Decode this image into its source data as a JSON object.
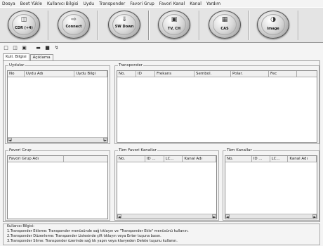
{
  "menu": [
    "Dosya",
    "Boot Yükle",
    "Kullanıcı Bilgisi",
    "Uydu",
    "Transponder",
    "Favori Grup",
    "Favori Kanal",
    "Kanal",
    "Yardım"
  ],
  "toolbar": {
    "buttons": [
      {
        "label": "CDR (+4)",
        "icon": "cdr-icon"
      },
      {
        "label": "Connect",
        "icon": "connect-icon"
      },
      {
        "label": "SW Down",
        "icon": "sw-down-icon"
      },
      {
        "label": "TV, CH",
        "icon": "tv-ch-icon"
      },
      {
        "label": "CAS",
        "icon": "cas-icon"
      },
      {
        "label": "Image",
        "icon": "image-icon"
      }
    ]
  },
  "small_toolbar": [
    "new-icon",
    "open-icon",
    "save-icon",
    "print-icon",
    "export-icon",
    "tools-icon"
  ],
  "tabs": [
    "Kull. Bilgisi",
    "Açıklama"
  ],
  "uydular": {
    "title": "Uydular",
    "columns": [
      "No",
      "Uydu Adı",
      "Uydu Bilgi"
    ]
  },
  "transponder": {
    "title": "Transponder",
    "columns": [
      "No.",
      "ID",
      "Frekans",
      "Sembol.",
      "Polar.",
      "Fec"
    ]
  },
  "favori_grup": {
    "title": "Favori Grup",
    "columns": [
      "Favori Grup Adı"
    ]
  },
  "tum_favori": {
    "title": "Tüm Favori Kanallar",
    "columns": [
      "No.",
      "ID ...",
      "LC...",
      "Kanal Adı"
    ]
  },
  "tum_kanallar": {
    "title": "Tüm Kanallar",
    "columns": [
      "No.",
      "ID ...",
      "LC...",
      "Kanal Adı"
    ]
  },
  "info": {
    "title": "Kullanıcı Bilgisi:",
    "lines": [
      "1.Transponder Ekleme: Transponder menüsünde sağ tıklayın ve \"Transponder Ekle\" menüsünü kullanın.",
      "2.Transponder Düzenleme: Transponder Listesinde çift tıklayın veya Enter tuşuna basın.",
      "3.Transponder Silme: Transponder üzerinde sağ tık yapın veya klavyeden Delete tuşunu kullanın."
    ]
  }
}
